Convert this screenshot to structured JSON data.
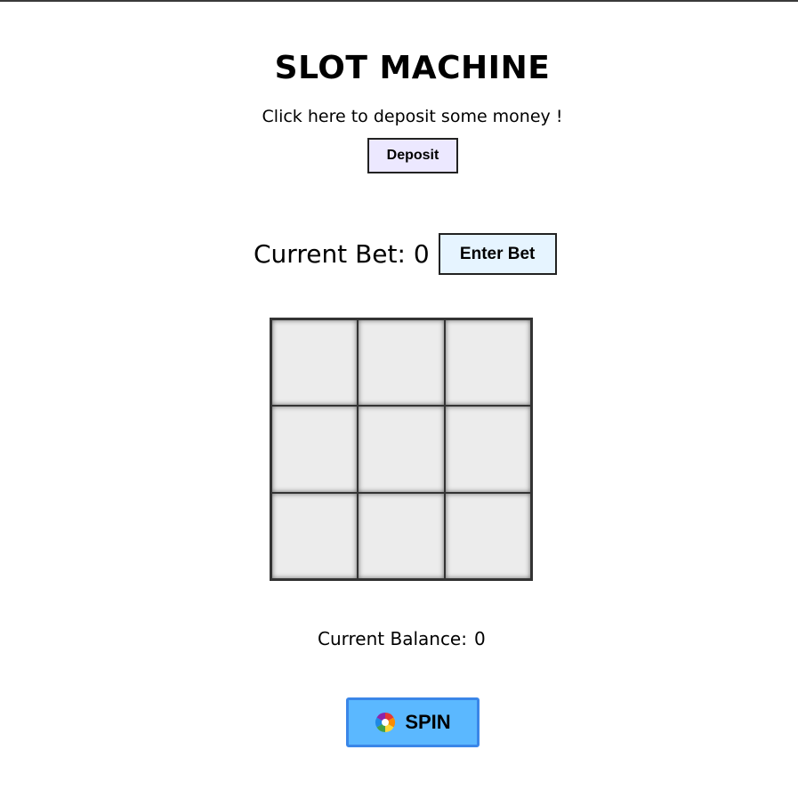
{
  "header": {
    "title": "SLOT MACHINE",
    "deposit_prompt": "Click here to deposit some money !",
    "deposit_label": "Deposit"
  },
  "bet": {
    "label": "Current Bet:",
    "value": "0",
    "button_label": "Enter Bet"
  },
  "reels": {
    "rows": 3,
    "cols": 3,
    "cells": [
      "",
      "",
      "",
      "",
      "",
      "",
      "",
      "",
      ""
    ]
  },
  "balance": {
    "label": "Current Balance:",
    "value": "0"
  },
  "spin": {
    "label": "SPIN",
    "icon": "color-wheel-icon"
  },
  "colors": {
    "deposit_bg": "#ece8ff",
    "enter_bet_bg": "#e6f4ff",
    "spin_bg": "#5bb8ff",
    "spin_border": "#3a86e8",
    "reel_bg": "#ececec"
  }
}
